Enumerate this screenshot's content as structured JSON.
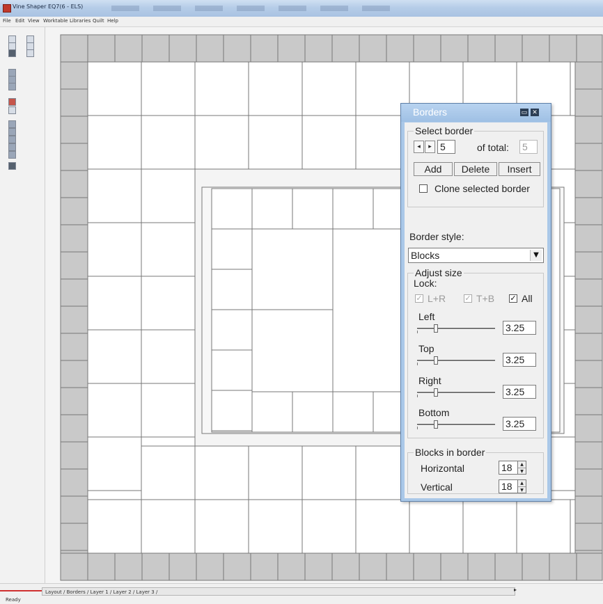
{
  "window": {
    "title": "Vine Shaper EQ7(6 - ELS)"
  },
  "menu": {
    "items": [
      "File",
      "Edit",
      "View",
      "Worktable",
      "Libraries",
      "Quilt",
      "Help"
    ]
  },
  "status": {
    "layer_tabs": "Layout / Borders / Layer 1 / Layer 2 / Layer 3 /",
    "text": "Ready"
  },
  "dialog": {
    "title": "Borders",
    "select_border": {
      "legend": "Select border",
      "current": "5",
      "of_total_label": "of total:",
      "total": "5",
      "add_label": "Add",
      "delete_label": "Delete",
      "insert_label": "Insert",
      "clone_label": "Clone selected border",
      "clone_checked": false
    },
    "border_style": {
      "label": "Border style:",
      "value": "Blocks"
    },
    "adjust_size": {
      "legend": "Adjust size",
      "lock_label": "Lock:",
      "lock_lr_label": "L+R",
      "lock_tb_label": "T+B",
      "lock_all_label": "All",
      "lock_lr_checked": true,
      "lock_tb_checked": true,
      "lock_all_checked": true,
      "left": {
        "label": "Left",
        "value": "3.25"
      },
      "top": {
        "label": "Top",
        "value": "3.25"
      },
      "right": {
        "label": "Right",
        "value": "3.25"
      },
      "bottom": {
        "label": "Bottom",
        "value": "3.25"
      }
    },
    "blocks_in_border": {
      "legend": "Blocks in border",
      "horizontal_label": "Horizontal",
      "horizontal_value": "18",
      "vertical_label": "Vertical",
      "vertical_value": "18"
    }
  },
  "colors": {
    "border_block": "#c9c9c9",
    "block_line": "#777777",
    "dialog_frame": "#aac8e8",
    "dialog_face": "#f0f0f0"
  }
}
